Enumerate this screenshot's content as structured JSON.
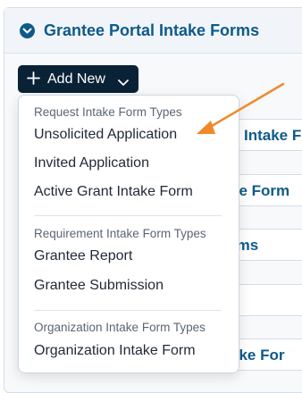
{
  "panel": {
    "title": "Grantee Portal Intake Forms"
  },
  "toolbar": {
    "add_new_label": "Add New"
  },
  "background_rows": [
    {
      "text": "Intake F"
    },
    {
      "text": "ke Form"
    },
    {
      "text": "rms"
    },
    {
      "text": ""
    },
    {
      "text": "ake For"
    }
  ],
  "dropdown": {
    "groups": [
      {
        "heading": "Request Intake Form Types",
        "items": [
          "Unsolicited Application",
          "Invited Application",
          "Active Grant Intake Form"
        ]
      },
      {
        "heading": "Requirement Intake Form Types",
        "items": [
          "Grantee Report",
          "Grantee Submission"
        ]
      },
      {
        "heading": "Organization Intake Form Types",
        "items": [
          "Organization Intake Form"
        ]
      }
    ]
  },
  "annotation": {
    "arrow_color": "#f0892b"
  },
  "colors": {
    "accent": "#0e5a8a",
    "button_bg": "#0a2236"
  }
}
